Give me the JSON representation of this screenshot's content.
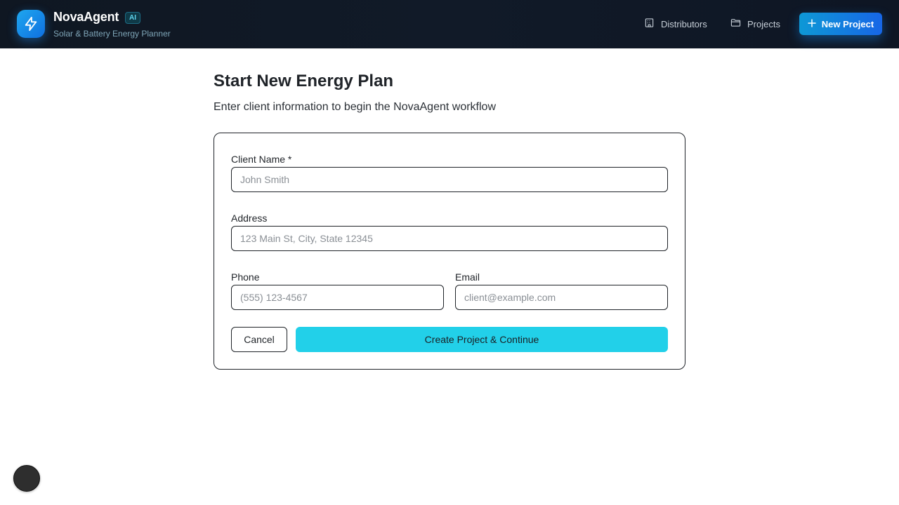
{
  "header": {
    "brand_title": "NovaAgent",
    "badge": "AI",
    "subtitle": "Solar & Battery Energy Planner",
    "logo_icon": "lightning-icon",
    "nav": [
      {
        "label": "Distributors",
        "icon": "building-icon"
      },
      {
        "label": "Projects",
        "icon": "folder-icon"
      }
    ],
    "new_project_label": "New Project",
    "accent_color": "#1e8ff0"
  },
  "main": {
    "title": "Start New Energy Plan",
    "subtitle": "Enter client information to begin the NovaAgent workflow",
    "form": {
      "client_name": {
        "label": "Client Name *",
        "placeholder": "John Smith",
        "value": ""
      },
      "address": {
        "label": "Address",
        "placeholder": "123 Main St, City, State 12345",
        "value": ""
      },
      "phone": {
        "label": "Phone",
        "placeholder": "(555) 123-4567",
        "value": ""
      },
      "email": {
        "label": "Email",
        "placeholder": "client@example.com",
        "value": ""
      },
      "cancel_label": "Cancel",
      "submit_label": "Create Project & Continue",
      "submit_color": "#22d0e9"
    }
  }
}
